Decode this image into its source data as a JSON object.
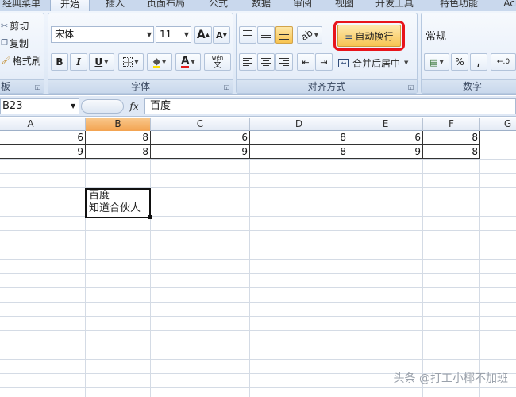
{
  "tabs": [
    "经典菜单",
    "开始",
    "插入",
    "页面布局",
    "公式",
    "数据",
    "审阅",
    "视图",
    "开发工具",
    "特色功能",
    "Acr"
  ],
  "clipboard": {
    "cut": "剪切",
    "copy": "复制",
    "format_painter": "格式刷",
    "label": "板"
  },
  "font": {
    "name": "宋体",
    "size": "11",
    "grow": "A",
    "shrink": "A",
    "bold": "B",
    "italic": "I",
    "underline": "U",
    "font_color_glyph": "A",
    "phonetic_top": "wén",
    "phonetic_bottom": "文",
    "label": "字体"
  },
  "alignment": {
    "wrap_text": "自动换行",
    "merge_center": "合并后居中",
    "label": "对齐方式"
  },
  "number": {
    "format": "常规",
    "percent": "%",
    "comma": ",",
    "label": "数字"
  },
  "formula_bar": {
    "name_box": "B23",
    "fx": "fx",
    "content": "百度"
  },
  "sheet": {
    "columns": [
      "A",
      "B",
      "C",
      "D",
      "E",
      "F",
      "G"
    ],
    "selected_column": "B",
    "rows": [
      [
        "6",
        "8",
        "6",
        "8",
        "6",
        "8"
      ],
      [
        "9",
        "8",
        "9",
        "8",
        "9",
        "8"
      ]
    ],
    "active_cell_lines": [
      "百度",
      "知道合伙人"
    ]
  },
  "watermark": "头条 @打工小椰不加班",
  "colors": {
    "highlight_box": "#e8141b",
    "selected_header": "#f3a350",
    "ribbon": "#dfe8f5"
  }
}
